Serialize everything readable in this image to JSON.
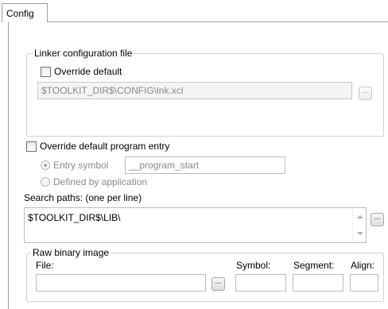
{
  "tabs": [
    {
      "label": "Config"
    }
  ],
  "linker_group": {
    "legend": "Linker configuration file",
    "override_label": "Override default",
    "path_value": "$TOOLKIT_DIR$\\CONFIG\\lnk.xcl",
    "browse_label": "..."
  },
  "program_entry": {
    "override_label": "Override default program entry",
    "entry_symbol_label": "Entry symbol",
    "entry_symbol_value": "__program_start",
    "defined_by_app_label": "Defined by application"
  },
  "search_paths": {
    "label": "Search paths:  (one per line)",
    "value": "$TOOLKIT_DIR$\\LIB\\",
    "browse_label": "..."
  },
  "raw_binary": {
    "legend": "Raw binary image",
    "file_label": "File:",
    "symbol_label": "Symbol:",
    "segment_label": "Segment:",
    "align_label": "Align:",
    "browse_label": "...",
    "file_value": "",
    "symbol_value": "",
    "segment_value": "",
    "align_value": ""
  }
}
